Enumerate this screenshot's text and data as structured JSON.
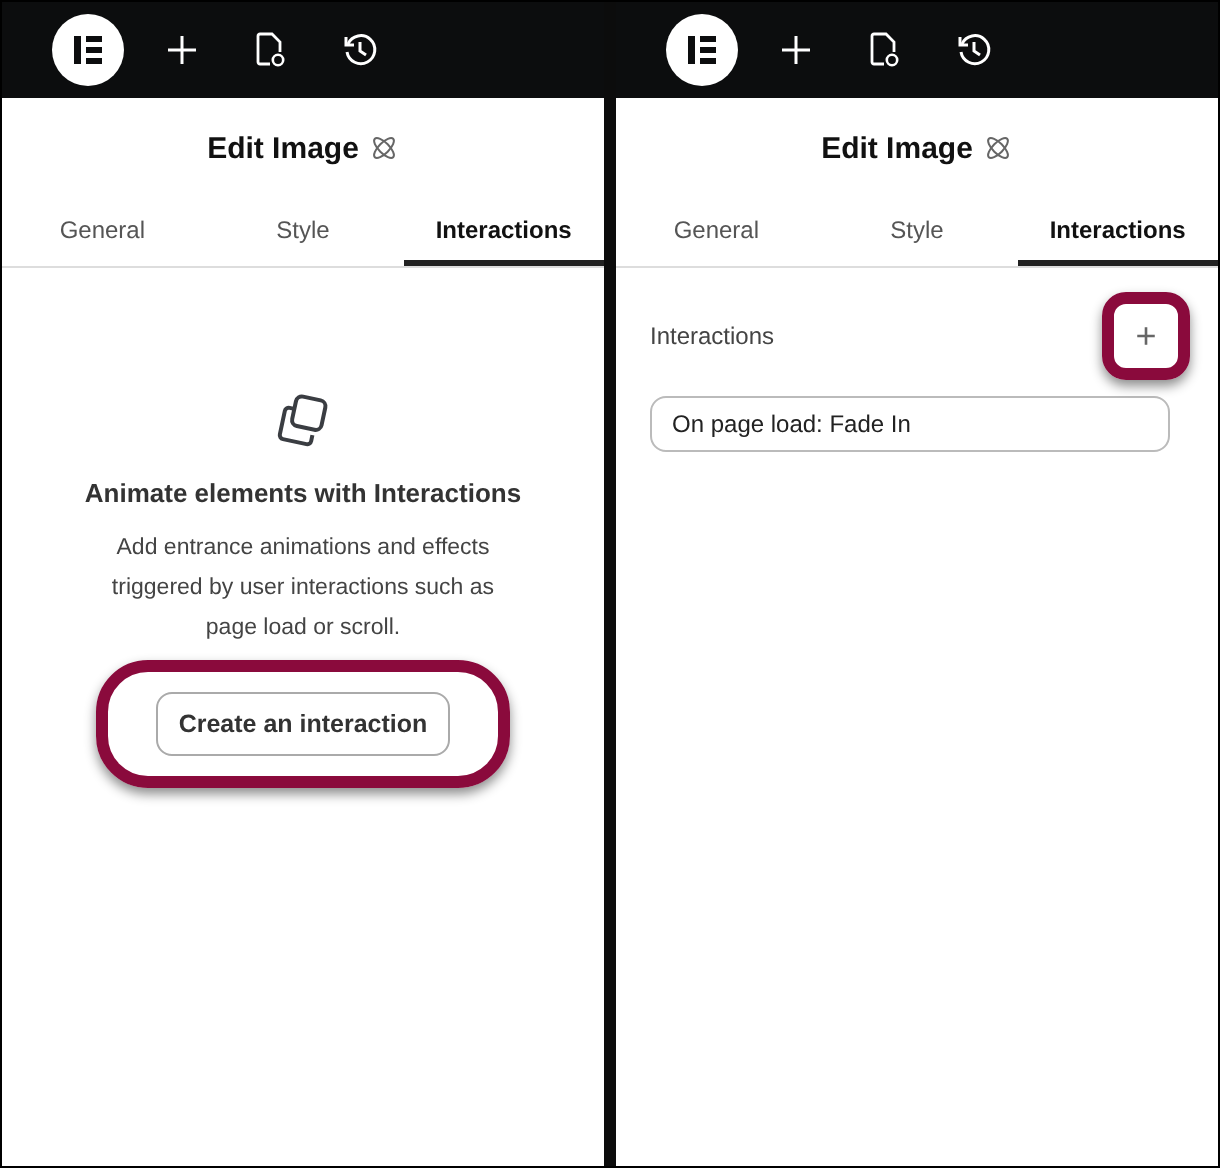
{
  "panels": [
    {
      "toolbar": {
        "items": [
          {
            "kind": "logo"
          },
          {
            "kind": "add"
          },
          {
            "kind": "page-settings"
          },
          {
            "kind": "history"
          }
        ]
      },
      "title": "Edit Image",
      "tabs": [
        {
          "label": "General",
          "selected": false
        },
        {
          "label": "Style",
          "selected": false
        },
        {
          "label": "Interactions",
          "selected": true
        }
      ],
      "content": {
        "kind": "empty",
        "heading": "Animate elements with Interactions",
        "description": "Add entrance animations and effects triggered by user interactions such as page load or scroll.",
        "button": {
          "label": "Create an interaction",
          "highlighted": true
        }
      }
    },
    {
      "toolbar": {
        "items": [
          {
            "kind": "logo"
          },
          {
            "kind": "add"
          },
          {
            "kind": "page-settings"
          },
          {
            "kind": "history"
          }
        ]
      },
      "title": "Edit Image",
      "tabs": [
        {
          "label": "General",
          "selected": false
        },
        {
          "label": "Style",
          "selected": false
        },
        {
          "label": "Interactions",
          "selected": true
        }
      ],
      "content": {
        "kind": "list",
        "label": "Interactions",
        "add_button": {
          "symbol": "+",
          "highlighted": true
        },
        "items": [
          "On page load: Fade In"
        ]
      }
    }
  ]
}
